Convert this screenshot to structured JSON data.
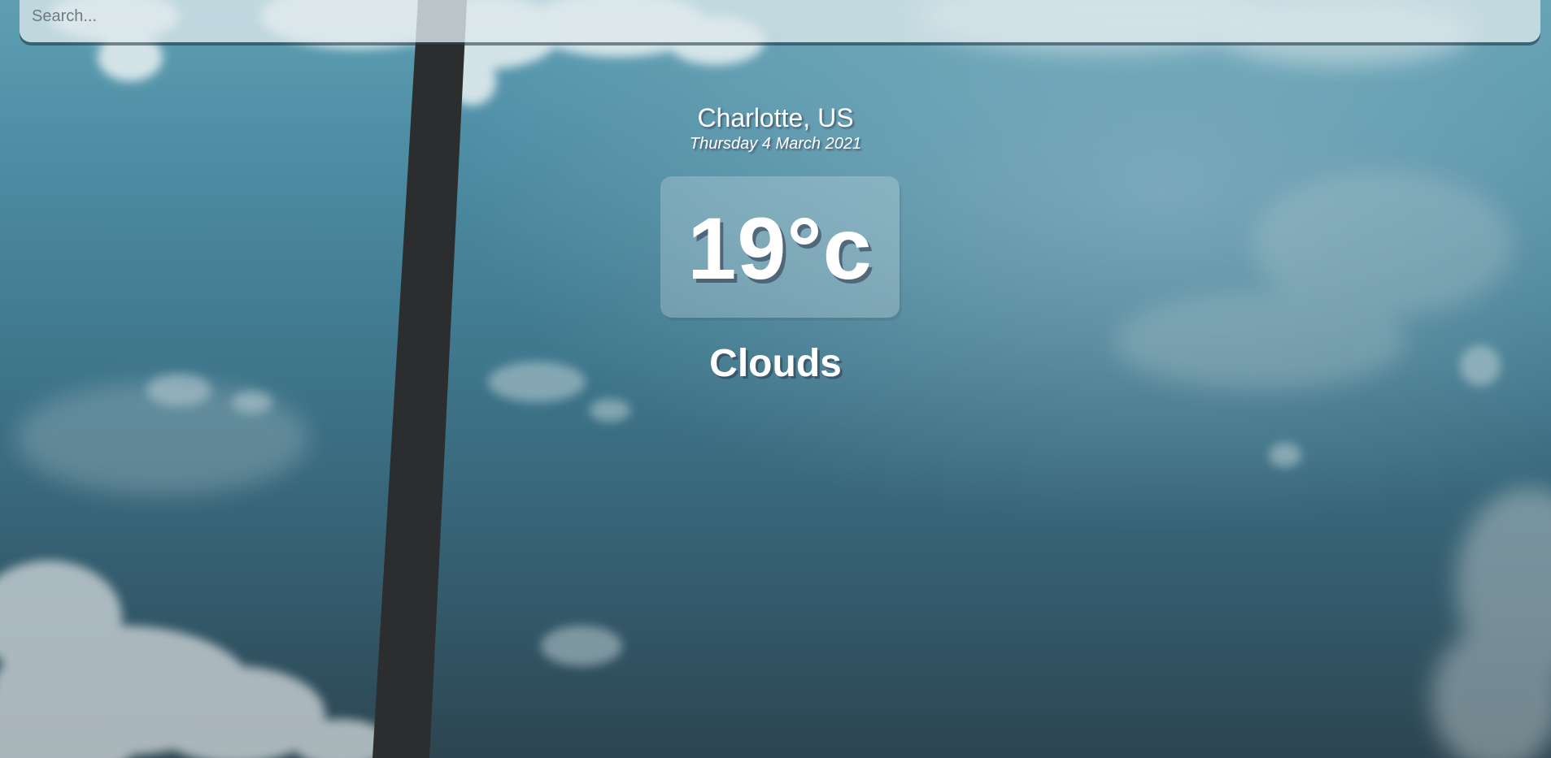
{
  "search": {
    "placeholder": "Search..."
  },
  "location": {
    "city": "Charlotte, US",
    "date": "Thursday 4 March 2021"
  },
  "weather": {
    "temperature": "19°c",
    "condition": "Clouds"
  },
  "colors": {
    "sky_top": "#5f9fb2",
    "sky_bottom": "#2c4550",
    "text": "#ffffff"
  }
}
